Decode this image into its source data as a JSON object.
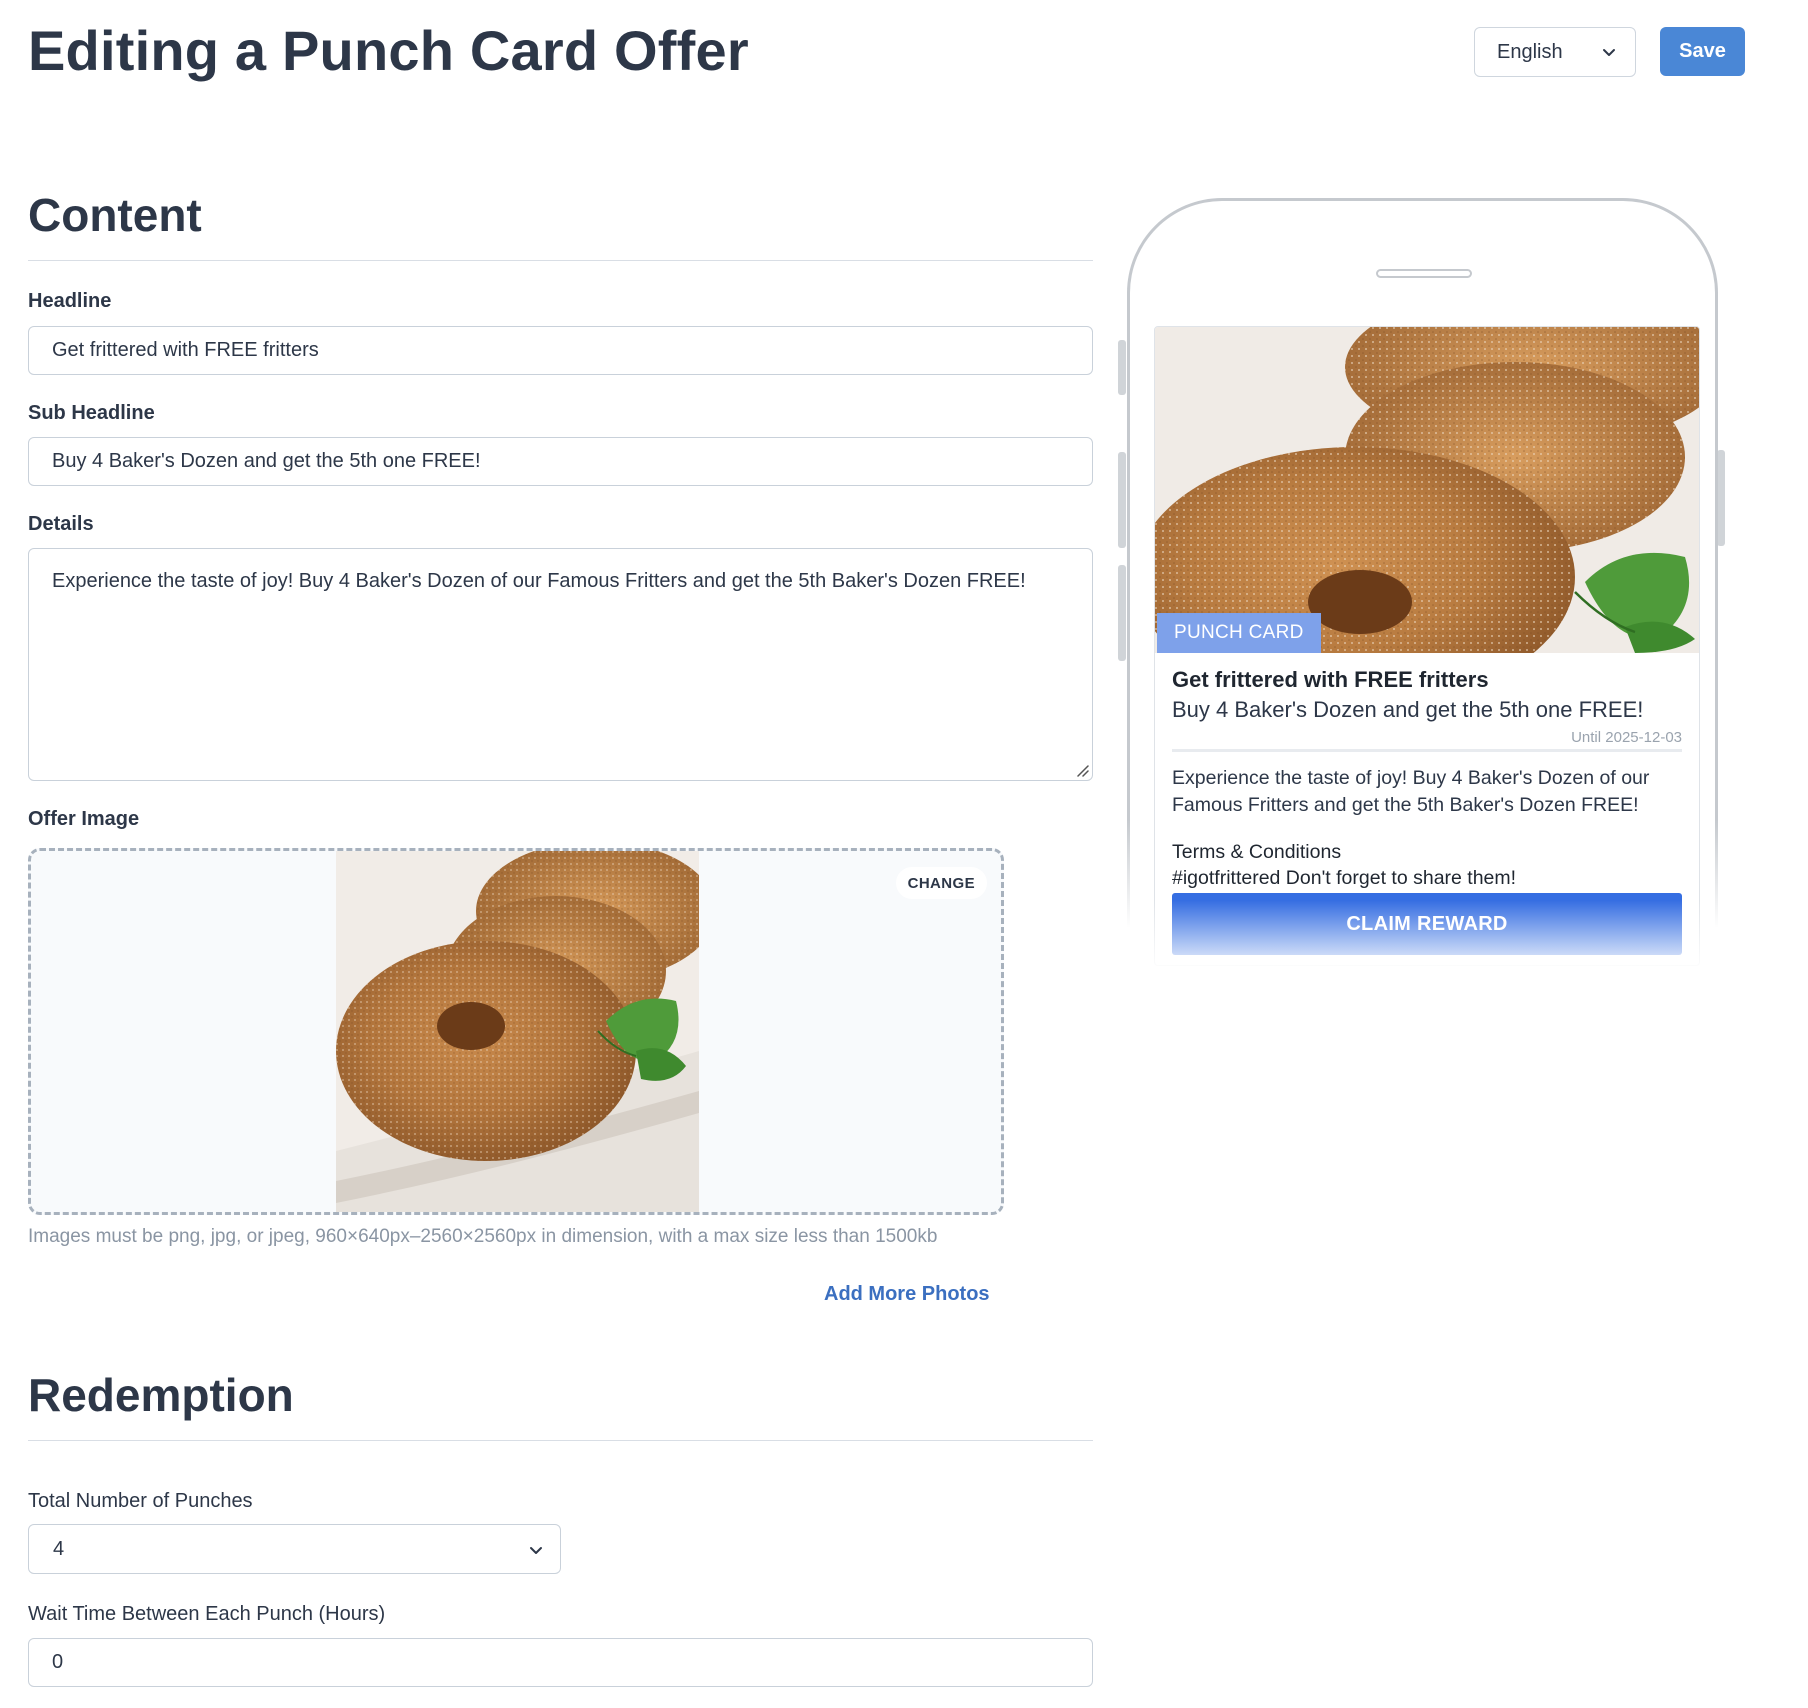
{
  "header": {
    "title": "Editing a Punch Card Offer",
    "language": "English",
    "save_label": "Save"
  },
  "content": {
    "section_title": "Content",
    "headline_label": "Headline",
    "headline_value": "Get frittered with FREE fritters",
    "subheadline_label": "Sub Headline",
    "subheadline_value": "Buy 4 Baker's Dozen and get the 5th one FREE!",
    "details_label": "Details",
    "details_value": "Experience the taste of joy! Buy 4 Baker's Dozen of our Famous Fritters and get the 5th Baker's Dozen FREE!",
    "image_label": "Offer Image",
    "change_label": "CHANGE",
    "image_hint": "Images must be png, jpg, or jpeg, 960×640px–2560×2560px in dimension, with a max size less than 1500kb",
    "add_photos_label": "Add More Photos"
  },
  "redemption": {
    "section_title": "Redemption",
    "punches_label": "Total Number of Punches",
    "punches_value": "4",
    "wait_label": "Wait Time Between Each Punch (Hours)",
    "wait_value": "0"
  },
  "preview": {
    "badge": "PUNCH CARD",
    "headline": "Get frittered with FREE fritters",
    "subheadline": "Buy 4 Baker's Dozen and get the 5th one FREE!",
    "until": "Until 2025-12-03",
    "details": "Experience the taste of joy! Buy 4 Baker's Dozen of our Famous Fritters and get the 5th Baker's Dozen FREE!",
    "terms_title": "Terms & Conditions",
    "terms_text": "#igotfrittered Don't forget to share them!",
    "claim_label": "CLAIM REWARD"
  },
  "icons": {
    "language_chevron": "chevron-down-icon",
    "punches_chevron": "chevron-down-icon",
    "textarea_resize": "resize-handle-icon"
  },
  "colors": {
    "accent": "#4a87d6",
    "claim_button": "#356ee2",
    "badge": "#7ea1ea",
    "link": "#3b6fc0",
    "text": "#2d3748"
  }
}
